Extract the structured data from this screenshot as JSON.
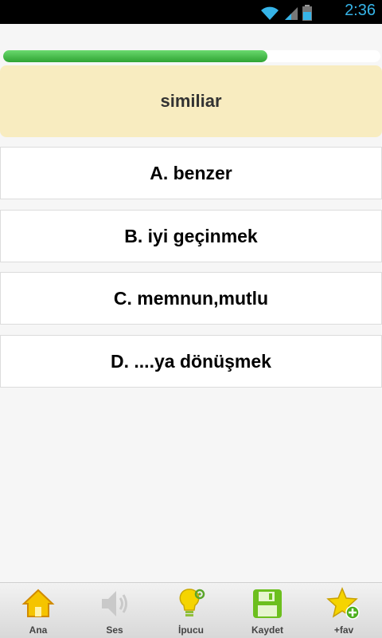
{
  "status_bar": {
    "time": "2:36"
  },
  "progress": {
    "fraction": 0.7
  },
  "question": {
    "text": "similiar"
  },
  "answers": [
    {
      "label": "A. benzer"
    },
    {
      "label": "B. iyi geçinmek"
    },
    {
      "label": "C. memnun,mutlu"
    },
    {
      "label": "D. ....ya dönüşmek"
    }
  ],
  "bottom_nav": {
    "home": {
      "label": "Ana",
      "icon": "home-icon"
    },
    "sound": {
      "label": "Ses",
      "icon": "speaker-icon"
    },
    "hint": {
      "label": "İpucu",
      "icon": "lightbulb-icon"
    },
    "save": {
      "label": "Kaydet",
      "icon": "floppy-disk-icon"
    },
    "fav": {
      "label": "+fav",
      "icon": "star-add-icon"
    }
  },
  "colors": {
    "progress": "#3fbf44",
    "question_bg": "#f8ecc0",
    "status_time": "#36b4e8"
  }
}
